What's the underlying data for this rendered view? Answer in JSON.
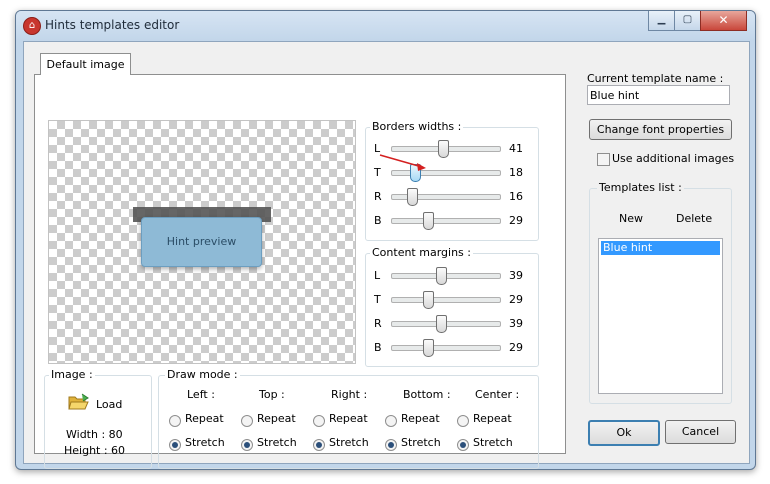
{
  "window": {
    "title": "Hints templates editor",
    "app_icon": "gem-icon"
  },
  "tab": {
    "label": "Default image"
  },
  "preview": {
    "hint_text": "Hint preview"
  },
  "borders": {
    "title": "Borders widths :",
    "rows": [
      {
        "label": "L",
        "value": "41"
      },
      {
        "label": "T",
        "value": "18"
      },
      {
        "label": "R",
        "value": "16"
      },
      {
        "label": "B",
        "value": "29"
      }
    ]
  },
  "margins": {
    "title": "Content margins :",
    "rows": [
      {
        "label": "L",
        "value": "39"
      },
      {
        "label": "T",
        "value": "29"
      },
      {
        "label": "R",
        "value": "39"
      },
      {
        "label": "B",
        "value": "29"
      }
    ]
  },
  "image": {
    "title": "Image :",
    "load_label": "Load",
    "width_text": "Width : 80",
    "height_text": "Height : 60"
  },
  "draw_mode": {
    "title": "Draw mode :",
    "columns": [
      {
        "header": "Left :",
        "repeat": "Repeat",
        "stretch": "Stretch",
        "selected": "stretch"
      },
      {
        "header": "Top :",
        "repeat": "Repeat",
        "stretch": "Stretch",
        "selected": "stretch"
      },
      {
        "header": "Right :",
        "repeat": "Repeat",
        "stretch": "Stretch",
        "selected": "stretch"
      },
      {
        "header": "Bottom :",
        "repeat": "Repeat",
        "stretch": "Stretch",
        "selected": "stretch"
      },
      {
        "header": "Center :",
        "repeat": "Repeat",
        "stretch": "Stretch",
        "selected": "stretch"
      }
    ]
  },
  "right": {
    "template_name_label": "Current template name :",
    "template_name_value": "Blue hint",
    "change_font_label": "Change font properties",
    "use_additional_label": "Use additional images",
    "templates_title": "Templates list :",
    "new_label": "New",
    "delete_label": "Delete",
    "templates": [
      "Blue hint"
    ],
    "ok_label": "Ok",
    "cancel_label": "Cancel"
  }
}
